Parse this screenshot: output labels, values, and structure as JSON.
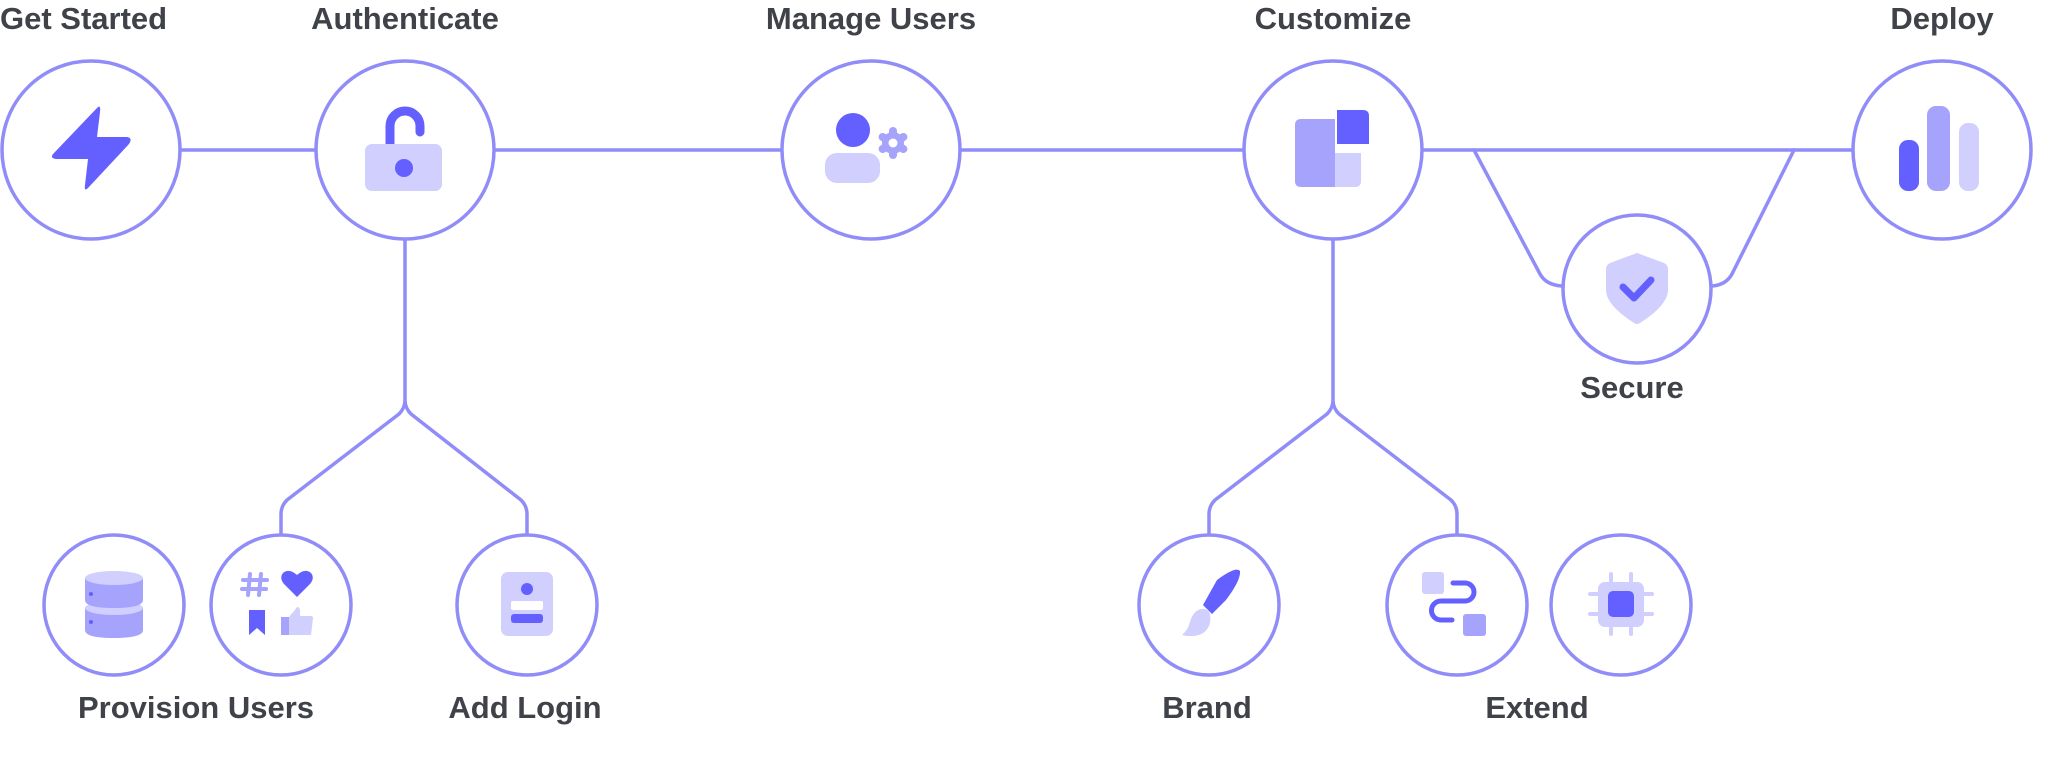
{
  "diagram": {
    "colors": {
      "line": "#908cf8",
      "primary": "#6360ff",
      "mid": "#a6a3fd",
      "light": "#d0cffd",
      "text": "#3f4248"
    },
    "main_steps": [
      {
        "id": "get-started",
        "label": "Get Started",
        "icon": "lightning-bolt-icon"
      },
      {
        "id": "authenticate",
        "label": "Authenticate",
        "icon": "unlocked-padlock-icon"
      },
      {
        "id": "manage-users",
        "label": "Manage Users",
        "icon": "user-settings-icon"
      },
      {
        "id": "customize",
        "label": "Customize",
        "icon": "layout-blocks-icon"
      },
      {
        "id": "deploy",
        "label": "Deploy",
        "icon": "bar-chart-icon"
      }
    ],
    "branches": [
      {
        "id": "secure",
        "label": "Secure",
        "parent": "customize",
        "icon": "shield-check-icon"
      },
      {
        "id": "provision-users",
        "label": "Provision Users",
        "parent": "authenticate",
        "icons": [
          "database-icon",
          "social-reactions-icon"
        ]
      },
      {
        "id": "add-login",
        "label": "Add Login",
        "parent": "authenticate",
        "icons": [
          "login-form-icon"
        ]
      },
      {
        "id": "brand",
        "label": "Brand",
        "parent": "customize",
        "icons": [
          "paintbrush-icon"
        ]
      },
      {
        "id": "extend",
        "label": "Extend",
        "parent": "customize",
        "icons": [
          "workflow-icon",
          "chip-icon"
        ]
      }
    ]
  }
}
